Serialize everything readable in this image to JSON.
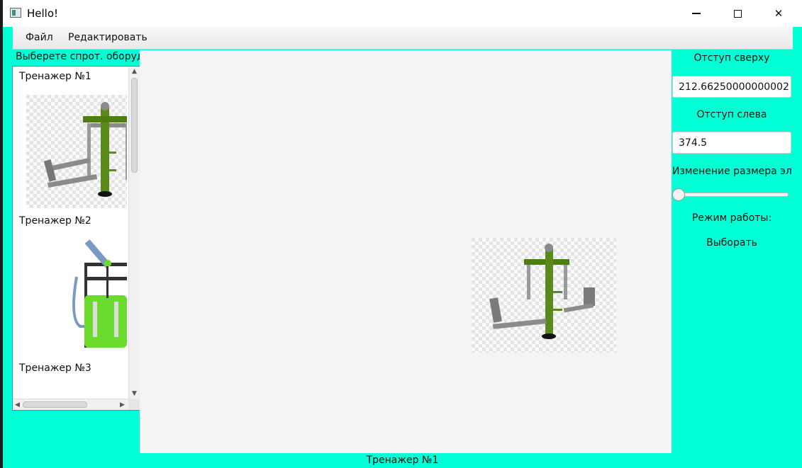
{
  "window": {
    "title": "Hello!",
    "icon": "app-window-icon"
  },
  "menu": {
    "items": [
      "Файл",
      "Редактировать"
    ]
  },
  "equipment_list": {
    "label": "Выберете спрот. оборудование",
    "items": [
      {
        "label": "Тренажер №1",
        "icon": "leg-press-machine-image"
      },
      {
        "label": "Тренажер №2",
        "icon": "lat-pulldown-machine-image"
      },
      {
        "label": "Тренажер №3",
        "icon": "equipment-image"
      }
    ]
  },
  "controls": {
    "top_offset_label": "Отступ сверху",
    "top_offset_value": "212.66250000000002",
    "left_offset_label": "Отступ слева",
    "left_offset_value": "374.5",
    "resize_label": "Изменение размера элемента",
    "resize_slider_level": 0,
    "mode_label": "Режим работы:",
    "mode_value": "Выборать"
  },
  "status": {
    "text": "Тренажер №1"
  },
  "colors": {
    "background": "#02ffd5",
    "canvas": "#f4f4f4",
    "machine_green": "#5a8a1a",
    "machine_grey": "#8b8b8b"
  }
}
